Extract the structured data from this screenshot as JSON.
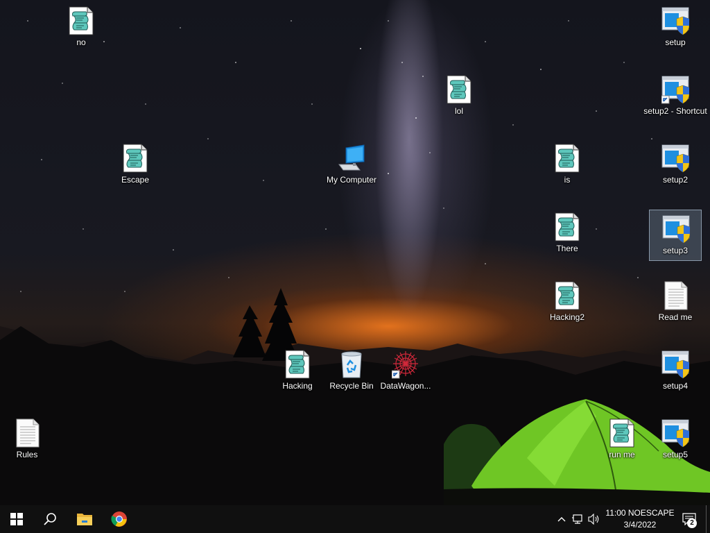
{
  "desktop": {
    "icons": [
      {
        "label": "no",
        "kind": "script"
      },
      {
        "label": "lol",
        "kind": "script"
      },
      {
        "label": "Escape",
        "kind": "script"
      },
      {
        "label": "My Computer",
        "kind": "computer"
      },
      {
        "label": "is",
        "kind": "script"
      },
      {
        "label": "There",
        "kind": "script"
      },
      {
        "label": "Hacking2",
        "kind": "script"
      },
      {
        "label": "Hacking",
        "kind": "script"
      },
      {
        "label": "Recycle Bin",
        "kind": "recycle-bin"
      },
      {
        "label": "DataWagon...",
        "kind": "shortcut-app"
      },
      {
        "label": "run me",
        "kind": "script"
      },
      {
        "label": "Rules",
        "kind": "text-file"
      },
      {
        "label": "setup",
        "kind": "installer"
      },
      {
        "label": "setup2 - Shortcut",
        "kind": "installer-shortcut"
      },
      {
        "label": "setup2",
        "kind": "installer"
      },
      {
        "label": "setup3",
        "kind": "installer",
        "selected": true
      },
      {
        "label": "Read me",
        "kind": "text-file"
      },
      {
        "label": "setup4",
        "kind": "installer"
      },
      {
        "label": "setup5",
        "kind": "installer"
      }
    ]
  },
  "taskbar": {
    "pinned": [
      "start-icon",
      "search-icon",
      "file-explorer-icon",
      "chrome-icon"
    ],
    "tray_icons": [
      "chevron-up-icon",
      "network-icon",
      "volume-icon"
    ],
    "clock_time": "11:00 NOESCAPE",
    "clock_date": "3/4/2022",
    "notification_count": "2"
  },
  "colors": {
    "taskbar": "#101010",
    "tent_green": "#7cd62a",
    "accent_blue": "#1e8fe0"
  }
}
